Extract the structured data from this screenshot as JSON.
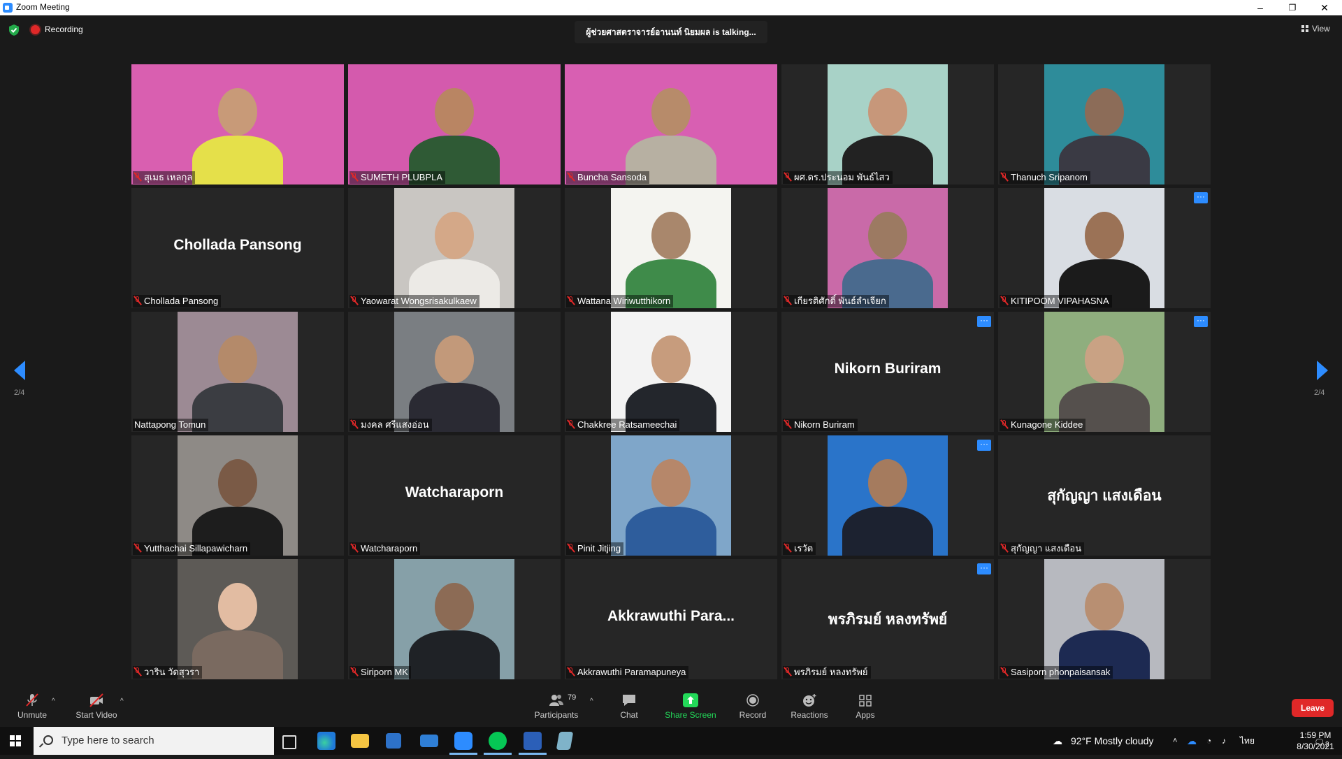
{
  "window": {
    "title": "Zoom Meeting",
    "minimize": "–",
    "restore": "❐",
    "close": "✕"
  },
  "top": {
    "recording_label": "Recording",
    "talking": "ผู้ช่วยศาสตราจารย์อานนท์ นิยมผล is talking...",
    "view_label": "View"
  },
  "pager": {
    "left": "2/4",
    "right": "2/4"
  },
  "participants": [
    {
      "name": "สุเมธ เหลกุล",
      "muted": true,
      "video": true,
      "bg": "#d95fb0",
      "head": "#c89a78",
      "shirt": "#e5e04a",
      "more": false
    },
    {
      "name": "SUMETH PLUBPLA",
      "muted": true,
      "video": true,
      "bg": "#d45aad",
      "head": "#b98563",
      "shirt": "#2f5a35",
      "more": false
    },
    {
      "name": "Buncha Sansoda",
      "muted": true,
      "video": true,
      "bg": "#d85fb2",
      "head": "#b78b6a",
      "shirt": "#b7b0a2",
      "more": false
    },
    {
      "name": "ผศ.ดร.ประนอม พันธ์ไสว",
      "muted": true,
      "video": true,
      "bg": "#a8d2c7",
      "head": "#c7977a",
      "shirt": "#222",
      "more": false
    },
    {
      "name": "Thanuch Sripanom",
      "muted": true,
      "video": true,
      "bg": "#2e8c9a",
      "head": "#8c6c58",
      "shirt": "#3a3a44",
      "more": false
    },
    {
      "name": "Chollada Pansong",
      "muted": true,
      "video": false,
      "display": "Chollada Pansong",
      "more": false
    },
    {
      "name": "Yaowarat Wongsrisakulkaew",
      "muted": true,
      "video": true,
      "bg": "#c9c6c2",
      "head": "#d4a888",
      "shirt": "#eceae6",
      "more": false
    },
    {
      "name": "Wattana Wiriwutthikorn",
      "muted": true,
      "video": true,
      "bg": "#f4f4f0",
      "head": "#a9876c",
      "shirt": "#3f8b4a",
      "more": false
    },
    {
      "name": "เกียรติศักดิ์ พันธ์ลำเจียก",
      "muted": true,
      "video": true,
      "bg": "#c96aa8",
      "head": "#9c7a62",
      "shirt": "#4a6a8e",
      "more": false
    },
    {
      "name": "KITIPOOM VIPAHASNA",
      "muted": true,
      "video": true,
      "bg": "#d9dde3",
      "head": "#9b7256",
      "shirt": "#1b1b1b",
      "more": true
    },
    {
      "name": "Nattapong Tomun",
      "muted": false,
      "video": true,
      "bg": "#9c8a94",
      "head": "#b48a6a",
      "shirt": "#3b3d42",
      "more": false
    },
    {
      "name": "มงคล ศรีแสงอ่อน",
      "muted": true,
      "video": true,
      "bg": "#7a7e82",
      "head": "#c2997a",
      "shirt": "#2a2a33",
      "more": false
    },
    {
      "name": "Chakkree Ratsameechai",
      "muted": true,
      "video": true,
      "bg": "#f3f3f3",
      "head": "#c79c7d",
      "shirt": "#23262c",
      "more": false
    },
    {
      "name": "Nikorn Buriram",
      "muted": true,
      "video": false,
      "display": "Nikorn Buriram",
      "more": true
    },
    {
      "name": "Kunagone Kiddee",
      "muted": true,
      "video": true,
      "bg": "#8fae7e",
      "head": "#c9a284",
      "shirt": "#55504d",
      "more": true
    },
    {
      "name": "Yutthachai Sillapawicharn",
      "muted": true,
      "video": true,
      "bg": "#8e8a86",
      "head": "#7a5a46",
      "shirt": "#1d1d1d",
      "more": false
    },
    {
      "name": "Watcharaporn",
      "muted": true,
      "video": false,
      "display": "Watcharaporn",
      "more": false
    },
    {
      "name": "Pinit Jitjing",
      "muted": true,
      "video": true,
      "bg": "#7fa6c9",
      "head": "#b6876a",
      "shirt": "#2e5d9c",
      "more": false
    },
    {
      "name": "เรวัต",
      "muted": true,
      "video": true,
      "bg": "#2a74c9",
      "head": "#a57b5e",
      "shirt": "#1c2230",
      "more": true
    },
    {
      "name": "สุกัญญา แสงเดือน",
      "muted": true,
      "video": false,
      "display": "สุกัญญา แสงเดือน",
      "more": false
    },
    {
      "name": "วาริน วัดสุวรา",
      "muted": true,
      "video": true,
      "bg": "#5d5a56",
      "head": "#e2bca2",
      "shirt": "#7a6a60",
      "more": false
    },
    {
      "name": "Siriporn MK",
      "muted": true,
      "video": true,
      "bg": "#86a0a8",
      "head": "#8c6b55",
      "shirt": "#1f2226",
      "more": false
    },
    {
      "name": "Akkrawuthi Paramapuneya",
      "muted": true,
      "video": false,
      "display": "Akkrawuthi Para...",
      "more": false
    },
    {
      "name": "พรภิรมย์ หลงทรัพย์",
      "muted": true,
      "video": false,
      "display": "พรภิรมย์ หลงทรัพย์",
      "more": true
    },
    {
      "name": "Sasiporn phonpaisansak",
      "muted": true,
      "video": true,
      "bg": "#b7b9bf",
      "head": "#b88f72",
      "shirt": "#1d2a52",
      "more": false
    }
  ],
  "toolbar": {
    "unmute": "Unmute",
    "start_video": "Start Video",
    "participants": "Participants",
    "participants_count": "79",
    "chat": "Chat",
    "share_screen": "Share Screen",
    "record": "Record",
    "reactions": "Reactions",
    "apps": "Apps",
    "leave": "Leave"
  },
  "taskbar": {
    "search_placeholder": "Type here to search",
    "weather": "92°F  Mostly cloudy",
    "language": "ไทย",
    "time": "1:59 PM",
    "date": "8/30/2021",
    "notifications": "2"
  },
  "colors": {
    "accent": "#2d8cff",
    "danger": "#e02828",
    "share": "#23d959"
  }
}
